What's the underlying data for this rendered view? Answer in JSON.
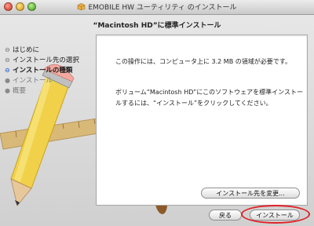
{
  "window": {
    "title": "EMOBILE HW ユーティリティ のインストール",
    "subtitle": "“Macintosh HD”に標準インストール"
  },
  "steps": [
    {
      "label": "はじめに",
      "state": "done"
    },
    {
      "label": "インストール先の選択",
      "state": "done"
    },
    {
      "label": "インストールの種類",
      "state": "current"
    },
    {
      "label": "インストール",
      "state": "pending"
    },
    {
      "label": "概要",
      "state": "pending"
    }
  ],
  "content": {
    "paragraph1": "この操作には、コンピュータ上に 3.2 MB の領域が必要です。",
    "paragraph2": "ボリューム“Macintosh HD”にこのソフトウェアを標準インストールするには、“インストール”をクリックしてください。"
  },
  "buttons": {
    "change_location": "インストール先を変更...",
    "back": "戻る",
    "install": "インストール"
  },
  "colors": {
    "highlight_circle": "#e0232a",
    "current_step_bullet": "#3a6bd8"
  }
}
